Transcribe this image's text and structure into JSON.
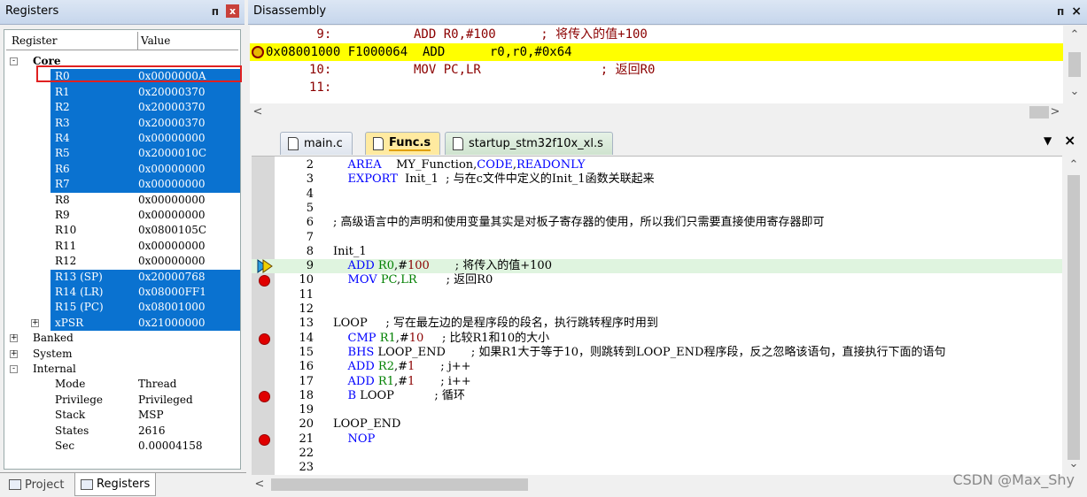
{
  "registers": {
    "title": "Registers",
    "pin": "ᴨ",
    "close": "x",
    "col_register": "Register",
    "col_value": "Value",
    "rows": [
      {
        "label": "Core",
        "value": "",
        "indent": 0,
        "exp": "-",
        "bold": true,
        "sel": false
      },
      {
        "label": "R0",
        "value": "0x0000000A",
        "indent": 1,
        "sel": true
      },
      {
        "label": "R1",
        "value": "0x20000370",
        "indent": 1,
        "sel": true
      },
      {
        "label": "R2",
        "value": "0x20000370",
        "indent": 1,
        "sel": true
      },
      {
        "label": "R3",
        "value": "0x20000370",
        "indent": 1,
        "sel": true
      },
      {
        "label": "R4",
        "value": "0x00000000",
        "indent": 1,
        "sel": true
      },
      {
        "label": "R5",
        "value": "0x2000010C",
        "indent": 1,
        "sel": true
      },
      {
        "label": "R6",
        "value": "0x00000000",
        "indent": 1,
        "sel": true
      },
      {
        "label": "R7",
        "value": "0x00000000",
        "indent": 1,
        "sel": true
      },
      {
        "label": "R8",
        "value": "0x00000000",
        "indent": 1,
        "sel": false
      },
      {
        "label": "R9",
        "value": "0x00000000",
        "indent": 1,
        "sel": false
      },
      {
        "label": "R10",
        "value": "0x0800105C",
        "indent": 1,
        "sel": false
      },
      {
        "label": "R11",
        "value": "0x00000000",
        "indent": 1,
        "sel": false
      },
      {
        "label": "R12",
        "value": "0x00000000",
        "indent": 1,
        "sel": false
      },
      {
        "label": "R13 (SP)",
        "value": "0x20000768",
        "indent": 1,
        "sel": true
      },
      {
        "label": "R14 (LR)",
        "value": "0x08000FF1",
        "indent": 1,
        "sel": true
      },
      {
        "label": "R15 (PC)",
        "value": "0x08001000",
        "indent": 1,
        "sel": true
      },
      {
        "label": "xPSR",
        "value": "0x21000000",
        "indent": 1,
        "exp": "+",
        "sel": true
      },
      {
        "label": "Banked",
        "value": "",
        "indent": 0,
        "exp": "+",
        "sel": false
      },
      {
        "label": "System",
        "value": "",
        "indent": 0,
        "exp": "+",
        "sel": false
      },
      {
        "label": "Internal",
        "value": "",
        "indent": 0,
        "exp": "-",
        "sel": false
      },
      {
        "label": "Mode",
        "value": "Thread",
        "indent": 1,
        "sel": false
      },
      {
        "label": "Privilege",
        "value": "Privileged",
        "indent": 1,
        "sel": false
      },
      {
        "label": "Stack",
        "value": "MSP",
        "indent": 1,
        "sel": false
      },
      {
        "label": "States",
        "value": "2616",
        "indent": 1,
        "sel": false
      },
      {
        "label": "Sec",
        "value": "0.00004158",
        "indent": 1,
        "sel": false
      }
    ],
    "tabs": {
      "project": "Project",
      "registers": "Registers"
    }
  },
  "disassembly": {
    "title": "Disassembly",
    "pin": "ᴨ",
    "close": "×",
    "lines": [
      {
        "text": "        9:           ADD R0,#100      ; 将传入的值+100",
        "cur": false
      },
      {
        "text": "0x08001000 F1000064  ADD      r0,r0,#0x64",
        "cur": true
      },
      {
        "text": "       10:           MOV PC,LR                ; 返回R0",
        "cur": false
      },
      {
        "text": "       11:",
        "cur": false
      }
    ]
  },
  "editor": {
    "tabs": [
      "main.c",
      "Func.s",
      "startup_stm32f10x_xl.s"
    ],
    "active_tab": 1,
    "menu": "▼",
    "close": "×",
    "watermark": "CSDN @Max_Shy"
  },
  "code": [
    {
      "n": "2",
      "html": "    <span class='kw'>AREA</span>    MY_Function,<span class='kw'>CODE</span>,<span class='kw'>READONLY</span>"
    },
    {
      "n": "3",
      "html": "    <span class='kw'>EXPORT</span>  Init_1  ; 与在c文件中定义的Init_1函数关联起来"
    },
    {
      "n": "4",
      "html": ""
    },
    {
      "n": "5",
      "html": ""
    },
    {
      "n": "6",
      "html": "; 高级语言中的声明和使用变量其实是对板子寄存器的使用，所以我们只需要直接使用寄存器即可"
    },
    {
      "n": "7",
      "html": ""
    },
    {
      "n": "8",
      "html": "Init_1"
    },
    {
      "n": "9",
      "html": "    <span class='kw'>ADD</span> <span class='reg'>R0</span>,#<span class='num'>100</span>       ; 将传入的值+100",
      "hl": true,
      "mark": "arrow"
    },
    {
      "n": "10",
      "html": "    <span class='kw'>MOV</span> <span class='reg'>PC</span>,<span class='reg'>LR</span>        ; 返回R0",
      "mark": "bp"
    },
    {
      "n": "11",
      "html": ""
    },
    {
      "n": "12",
      "html": ""
    },
    {
      "n": "13",
      "html": "LOOP     ; 写在最左边的是程序段的段名，执行跳转程序时用到"
    },
    {
      "n": "14",
      "html": "    <span class='kw'>CMP</span> <span class='reg'>R1</span>,#<span class='num'>10</span>     ; 比较R1和10的大小",
      "mark": "bp"
    },
    {
      "n": "15",
      "html": "    <span class='kw'>BHS</span> LOOP_END       ; 如果R1大于等于10，则跳转到LOOP_END程序段，反之忽略该语句，直接执行下面的语句"
    },
    {
      "n": "16",
      "html": "    <span class='kw'>ADD</span> <span class='reg'>R2</span>,#<span class='num'>1</span>       ; j++"
    },
    {
      "n": "17",
      "html": "    <span class='kw'>ADD</span> <span class='reg'>R1</span>,#<span class='num'>1</span>       ; i++"
    },
    {
      "n": "18",
      "html": "    <span class='kw'>B</span> LOOP           ; 循环",
      "mark": "bp"
    },
    {
      "n": "19",
      "html": ""
    },
    {
      "n": "20",
      "html": "LOOP_END"
    },
    {
      "n": "21",
      "html": "    <span class='kw'>NOP</span>",
      "mark": "bp"
    },
    {
      "n": "22",
      "html": ""
    },
    {
      "n": "23",
      "html": ""
    }
  ]
}
